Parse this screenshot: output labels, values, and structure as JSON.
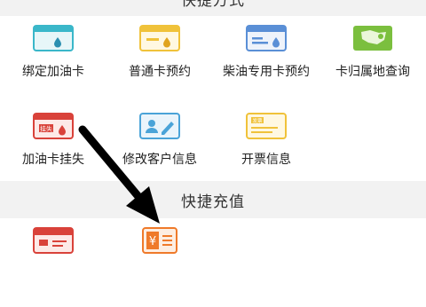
{
  "sections": {
    "quick_methods": {
      "title": "快捷方式"
    },
    "quick_topup": {
      "title": "快捷充值"
    }
  },
  "quick_methods_items": [
    {
      "label": "绑定加油卡",
      "icon": "card-bind-icon",
      "color": "#3ab7c9"
    },
    {
      "label": "普通卡预约",
      "icon": "card-reserve-icon",
      "color": "#f0c23a"
    },
    {
      "label": "柴油专用卡预约",
      "icon": "diesel-card-reserve-icon",
      "color": "#5a8fd6"
    },
    {
      "label": "卡归属地查询",
      "icon": "card-location-icon",
      "color": "#7bbf3e"
    },
    {
      "label": "加油卡挂失",
      "icon": "card-report-loss-icon",
      "color": "#d9423a"
    },
    {
      "label": "修改客户信息",
      "icon": "edit-customer-icon",
      "color": "#4aa3d8"
    },
    {
      "label": "开票信息",
      "icon": "invoice-icon",
      "color": "#f0c23a"
    }
  ],
  "quick_topup_items": [
    {
      "label": "",
      "icon": "topup-card-icon",
      "color": "#d9423a"
    },
    {
      "label": "",
      "icon": "yuan-topup-icon",
      "color": "#ef7a2a"
    }
  ],
  "icon_text": {
    "report_loss": "挂失",
    "invoice": "发票",
    "yuan": "¥"
  }
}
